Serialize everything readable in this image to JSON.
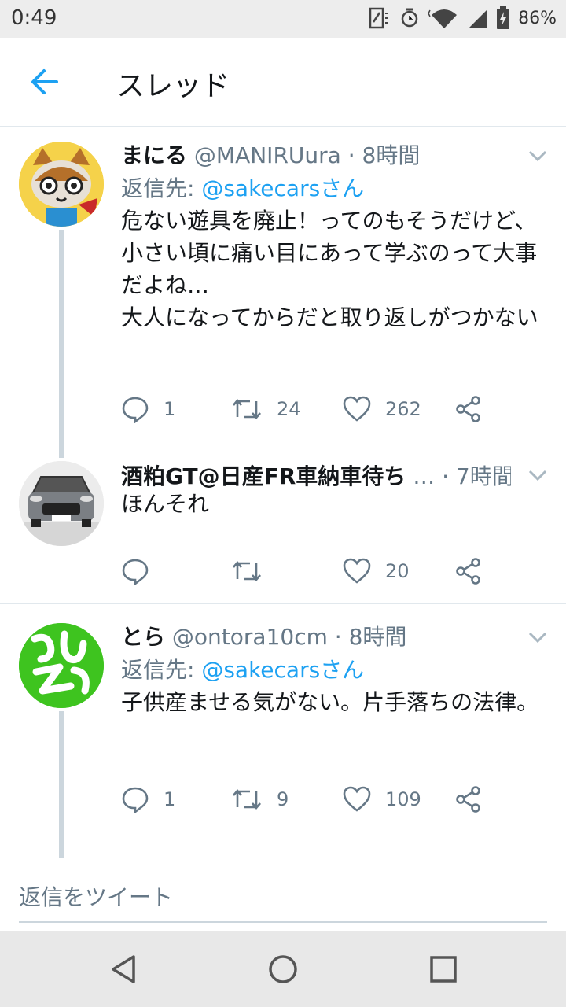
{
  "status_bar": {
    "time": "0:49",
    "battery": "86%"
  },
  "app_bar": {
    "title": "スレッド"
  },
  "tweets": [
    {
      "name": "まにる",
      "handle": "@MANIRUura",
      "sep": "·",
      "time": "8時間",
      "reply_label": "返信先:",
      "reply_to": "@sakecarsさん",
      "text": "危ない遊具を廃止！ってのもそうだけど、小さい頃に痛い目にあって学ぶのって大事だよね…\n大人になってからだと取り返しがつかない",
      "replies": "1",
      "retweets": "24",
      "likes": "262"
    },
    {
      "name": "酒粕GT@日産FR車納車待ち",
      "handle": "…",
      "sep": "·",
      "time": "7時間",
      "text": "ほんそれ",
      "replies": "",
      "retweets": "",
      "likes": "20"
    },
    {
      "name": "とら",
      "handle": "@ontora10cm",
      "sep": "·",
      "time": "8時間",
      "reply_label": "返信先:",
      "reply_to": "@sakecarsさん",
      "text": "子供産ませる気がない。片手落ちの法律。",
      "replies": "1",
      "retweets": "9",
      "likes": "109"
    }
  ],
  "composer": {
    "placeholder": "返信をツイート"
  },
  "colors": {
    "accent": "#1da1f2",
    "secondary_text": "#657786",
    "thread_line": "#ccd6dd",
    "avatar3_bg": "#3ec41f"
  },
  "icons": {
    "back": "arrow-left-icon",
    "caret": "chevron-down-icon",
    "reply": "reply-icon",
    "retweet": "retweet-icon",
    "like": "heart-icon",
    "share": "share-icon"
  }
}
